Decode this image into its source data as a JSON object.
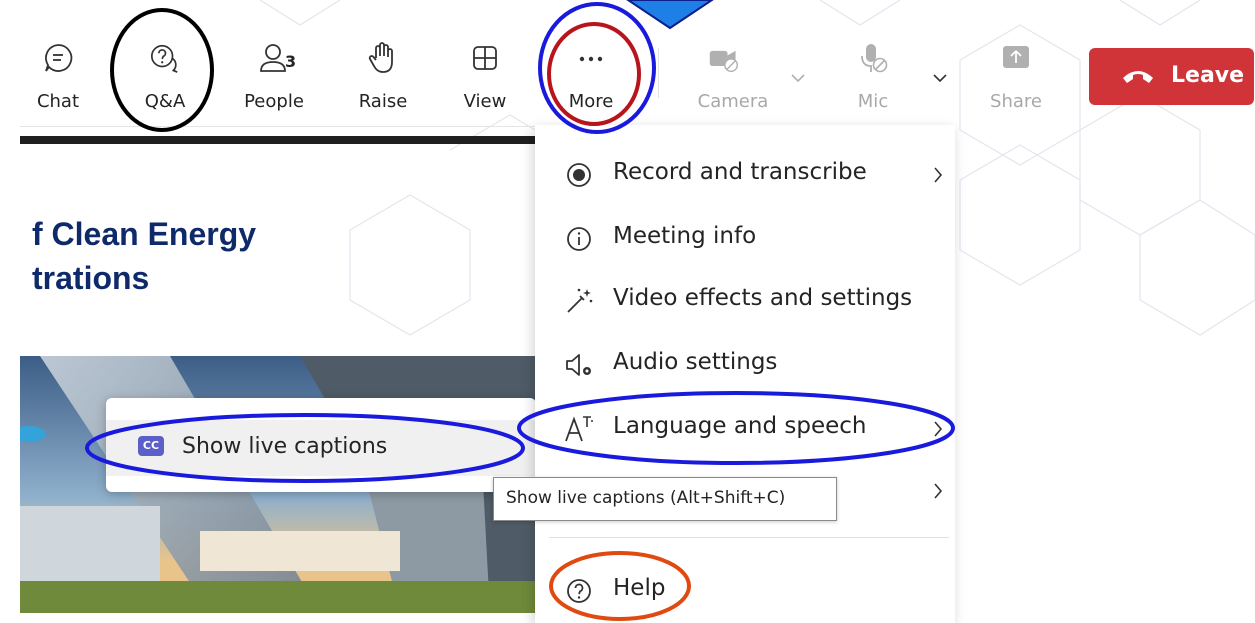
{
  "toolbar": {
    "chat_label": "Chat",
    "qa_label": "Q&A",
    "people_label": "People",
    "people_count": "3",
    "raise_label": "Raise",
    "view_label": "View",
    "more_label": "More",
    "camera_label": "Camera",
    "mic_label": "Mic",
    "share_label": "Share",
    "leave_label": "Leave"
  },
  "slide": {
    "title_line1": "f Clean Energy",
    "title_line2": "trations"
  },
  "more_menu": {
    "items": [
      {
        "label": "Record and transcribe",
        "icon": "record-icon"
      },
      {
        "label": "Meeting info",
        "icon": "info-icon"
      },
      {
        "label": "Video effects and settings",
        "icon": "magic-wand-icon"
      },
      {
        "label": "Audio settings",
        "icon": "speaker-settings-icon"
      },
      {
        "label": "Language and speech",
        "icon": "language-icon"
      },
      {
        "label": "Help",
        "icon": "help-icon"
      }
    ]
  },
  "submenu": {
    "show_captions_label": "Show live captions",
    "cc_badge": "CC"
  },
  "tooltip": {
    "text": "Show live captions (Alt+Shift+C)"
  },
  "colors": {
    "leave": "#d13438",
    "accent": "#5b5fc7",
    "annotation_black": "#000000",
    "annotation_blue": "#1a1adc",
    "annotation_red": "#b8141c",
    "annotation_orange": "#e04a10",
    "arrow_fill": "#1e7fe6"
  }
}
